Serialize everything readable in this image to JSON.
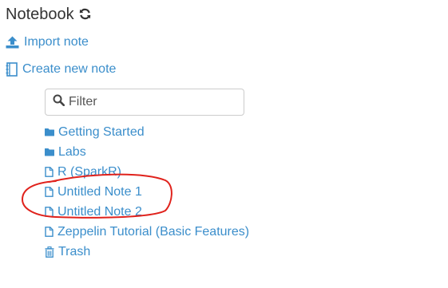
{
  "header": {
    "title": "Notebook",
    "refresh_icon": "refresh-icon"
  },
  "actions": {
    "import_label": "Import note",
    "import_icon": "upload-icon",
    "create_label": "Create new note",
    "create_icon": "notebook-icon"
  },
  "filter": {
    "placeholder": "Filter",
    "value": "",
    "icon": "search-icon"
  },
  "tree": {
    "items": [
      {
        "label": "Getting Started",
        "icon": "folder-icon"
      },
      {
        "label": "Labs",
        "icon": "folder-icon"
      },
      {
        "label": "R (SparkR)",
        "icon": "file-icon"
      },
      {
        "label": "Untitled Note 1",
        "icon": "file-icon"
      },
      {
        "label": "Untitled Note 2",
        "icon": "file-icon"
      },
      {
        "label": "Zeppelin Tutorial (Basic Features)",
        "icon": "file-icon"
      },
      {
        "label": "Trash",
        "icon": "trash-icon"
      }
    ]
  },
  "colors": {
    "link": "#3b8ecb",
    "annotation": "#e0221c",
    "title": "#333333"
  }
}
